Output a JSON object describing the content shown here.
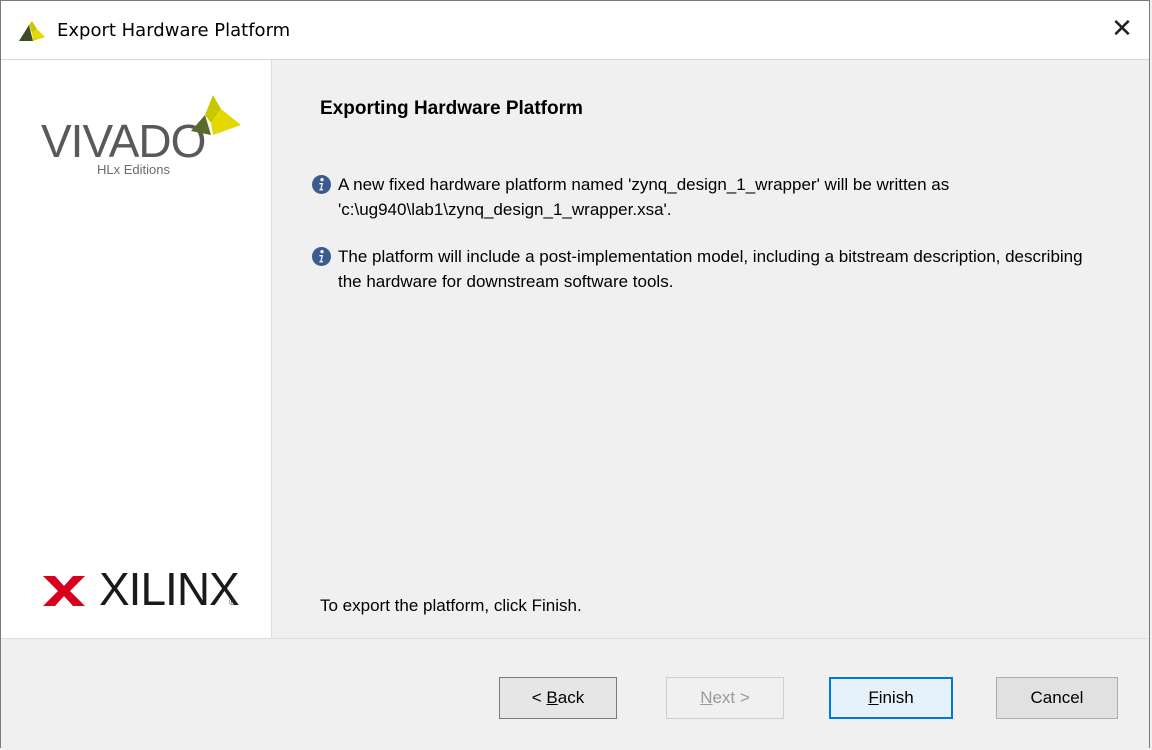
{
  "window": {
    "title": "Export Hardware Platform",
    "close_label": "✕"
  },
  "branding": {
    "product": "VIVADO",
    "edition": "HLx Editions",
    "company": "XILINX",
    "company_mark": "®"
  },
  "main": {
    "heading": "Exporting Hardware Platform",
    "info_lines": [
      "A new fixed hardware platform named 'zynq_design_1_wrapper' will be written as 'c:\\ug940\\lab1\\zynq_design_1_wrapper.xsa'.",
      "The platform will include a post-implementation model, including a bitstream description, describing the hardware for downstream software tools."
    ],
    "finish_note": "To export the platform, click Finish."
  },
  "footer": {
    "back": {
      "prefix": "< ",
      "mnemonic": "B",
      "rest": "ack"
    },
    "next": {
      "mnemonic": "N",
      "rest": "ext >"
    },
    "finish": {
      "mnemonic": "F",
      "rest": "inish"
    },
    "cancel": "Cancel"
  },
  "colors": {
    "accent": "#0078d7",
    "info_icon": "#3b5b8f",
    "logo_yellow": "#c8c800",
    "xilinx_red": "#d6001c"
  }
}
